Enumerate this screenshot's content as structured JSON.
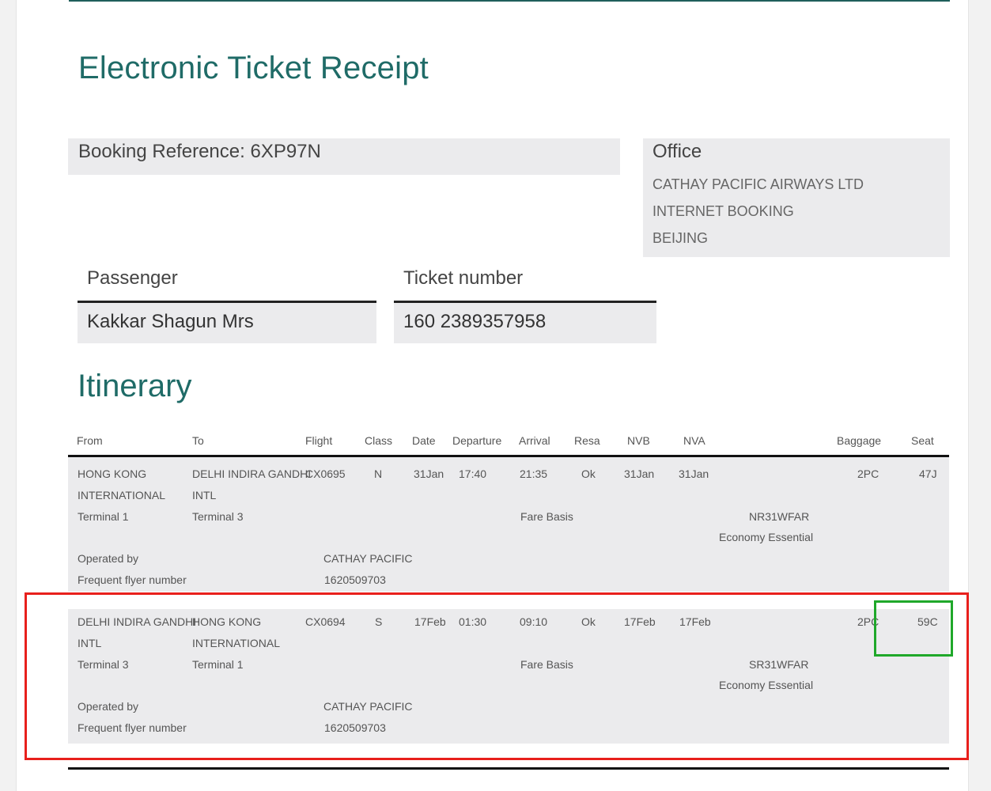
{
  "title": "Electronic Ticket Receipt",
  "booking": {
    "label": "Booking Reference: 6XP97N"
  },
  "office": {
    "title": "Office",
    "lines": [
      "CATHAY PACIFIC AIRWAYS LTD",
      "INTERNET BOOKING",
      "BEIJING"
    ]
  },
  "passenger": {
    "label": "Passenger",
    "value": "Kakkar Shagun Mrs"
  },
  "ticket": {
    "label": "Ticket number",
    "value": "160 2389357958"
  },
  "itinerary": {
    "title": "Itinerary",
    "headers": {
      "from": "From",
      "to": "To",
      "flight": "Flight",
      "class": "Class",
      "date": "Date",
      "departure": "Departure",
      "arrival": "Arrival",
      "resa": "Resa",
      "nvb": "NVB",
      "nva": "NVA",
      "baggage": "Baggage",
      "seat": "Seat"
    },
    "segments": [
      {
        "from_1": "HONG KONG",
        "from_2": "INTERNATIONAL",
        "from_terminal": "Terminal 1",
        "to_1": "DELHI INDIRA GANDHI",
        "to_2": "INTL",
        "to_terminal": "Terminal 3",
        "flight": "CX0695",
        "class": "N",
        "date": "31Jan",
        "departure": "17:40",
        "arrival": "21:35",
        "resa": "Ok",
        "nvb": "31Jan",
        "nva": "31Jan",
        "baggage": "2PC",
        "seat": "47J",
        "fare_basis_label": "Fare Basis",
        "fare_basis": "NR31WFAR",
        "fare_family": "Economy Essential",
        "operated_by_label": "Operated by",
        "operated_by": "CATHAY PACIFIC",
        "ffn_label": "Frequent flyer number",
        "ffn": "1620509703"
      },
      {
        "from_1": "DELHI INDIRA GANDHI",
        "from_2": "INTL",
        "from_terminal": "Terminal 3",
        "to_1": "HONG KONG",
        "to_2": "INTERNATIONAL",
        "to_terminal": "Terminal 1",
        "flight": "CX0694",
        "class": "S",
        "date": "17Feb",
        "departure": "01:30",
        "arrival": "09:10",
        "resa": "Ok",
        "nvb": "17Feb",
        "nva": "17Feb",
        "baggage": "2PC",
        "seat": "59C",
        "fare_basis_label": "Fare Basis",
        "fare_basis": "SR31WFAR",
        "fare_family": "Economy Essential",
        "operated_by_label": "Operated by",
        "operated_by": "CATHAY PACIFIC",
        "ffn_label": "Frequent flyer number",
        "ffn": "1620509703"
      }
    ]
  },
  "highlights": {
    "segment_color": "#e8201c",
    "seat_color": "#1fa82a"
  }
}
